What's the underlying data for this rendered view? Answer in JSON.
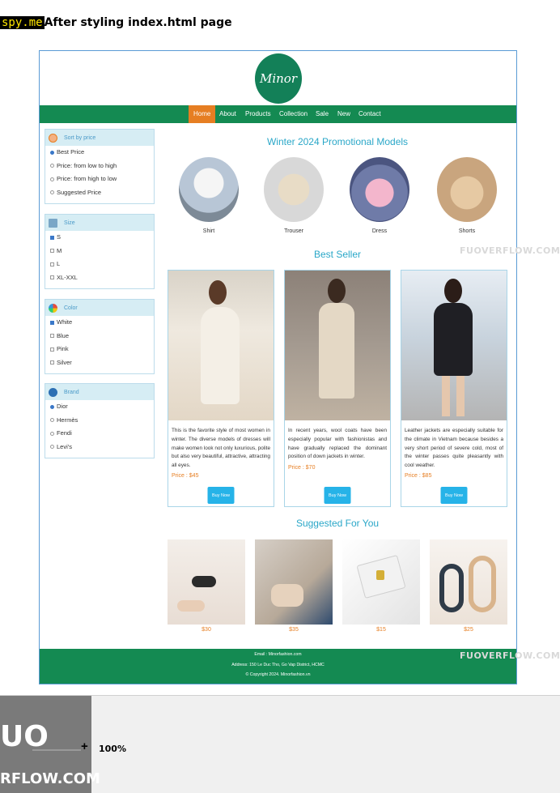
{
  "doc": {
    "watermark": "spy.me",
    "title": "After styling index.html page"
  },
  "logo": {
    "text": "Minor"
  },
  "nav": {
    "items": [
      "Home",
      "About",
      "Products",
      "Collection",
      "Sale",
      "New",
      "Contact"
    ],
    "active": "Home"
  },
  "sidebar": {
    "sort": {
      "title": "Sort by price",
      "options": [
        "Best Price",
        "Price: from low to high",
        "Price: from high to low",
        "Suggested Price"
      ]
    },
    "size": {
      "title": "Size",
      "options": [
        "S",
        "M",
        "L",
        "XL-XXL"
      ]
    },
    "color": {
      "title": "Color",
      "options": [
        "White",
        "Blue",
        "Pink",
        "Silver"
      ]
    },
    "brand": {
      "title": "Brand",
      "options": [
        "Dior",
        "Hermès",
        "Fendi",
        "Levi's"
      ]
    }
  },
  "promo": {
    "title": "Winter 2024 Promotional Models",
    "items": [
      "Shirt",
      "Trouser",
      "Dress",
      "Shorts"
    ]
  },
  "bestseller": {
    "title": "Best Seller",
    "cards": [
      {
        "desc": "This is the favorite style of most women in winter. The diverse models of dresses will make women look not only luxurious, polite but also very beautiful, attractive, attracting all eyes.",
        "price": "Price : $45",
        "button": "Buy Now"
      },
      {
        "desc": "In recent years, wool coats have been especially popular with fashionistas and have gradually replaced the dominant position of down jackets in winter.",
        "price": "Price : $70",
        "button": "Buy Now"
      },
      {
        "desc": "Leather jackets are especially suitable for the climate in Vietnam because besides a very short period of severe cold, most of the winter passes quite pleasantly with cool weather.",
        "price": "Price : $85",
        "button": "Buy Now"
      }
    ]
  },
  "suggested": {
    "title": "Suggested For You",
    "prices": [
      "$30",
      "$35",
      "$15",
      "$25"
    ]
  },
  "footer": {
    "email": "Email : Minorfashion.com",
    "address": "Address: 150 Le Duc Tho, Go Vap District, HCMC",
    "copyright": "© Copyright 2024. Minorfashion.vn"
  },
  "watermarks": {
    "right": "FUOVERFLOW.COM"
  },
  "bottombar": {
    "logo_big": "UO",
    "logo_small": "RFLOW.COM",
    "zoom_plus": "+",
    "zoom": "100%"
  },
  "colors": {
    "green": "#148a52",
    "orange": "#e67e22",
    "teal": "#2aa7c8",
    "button": "#26b3e8"
  }
}
